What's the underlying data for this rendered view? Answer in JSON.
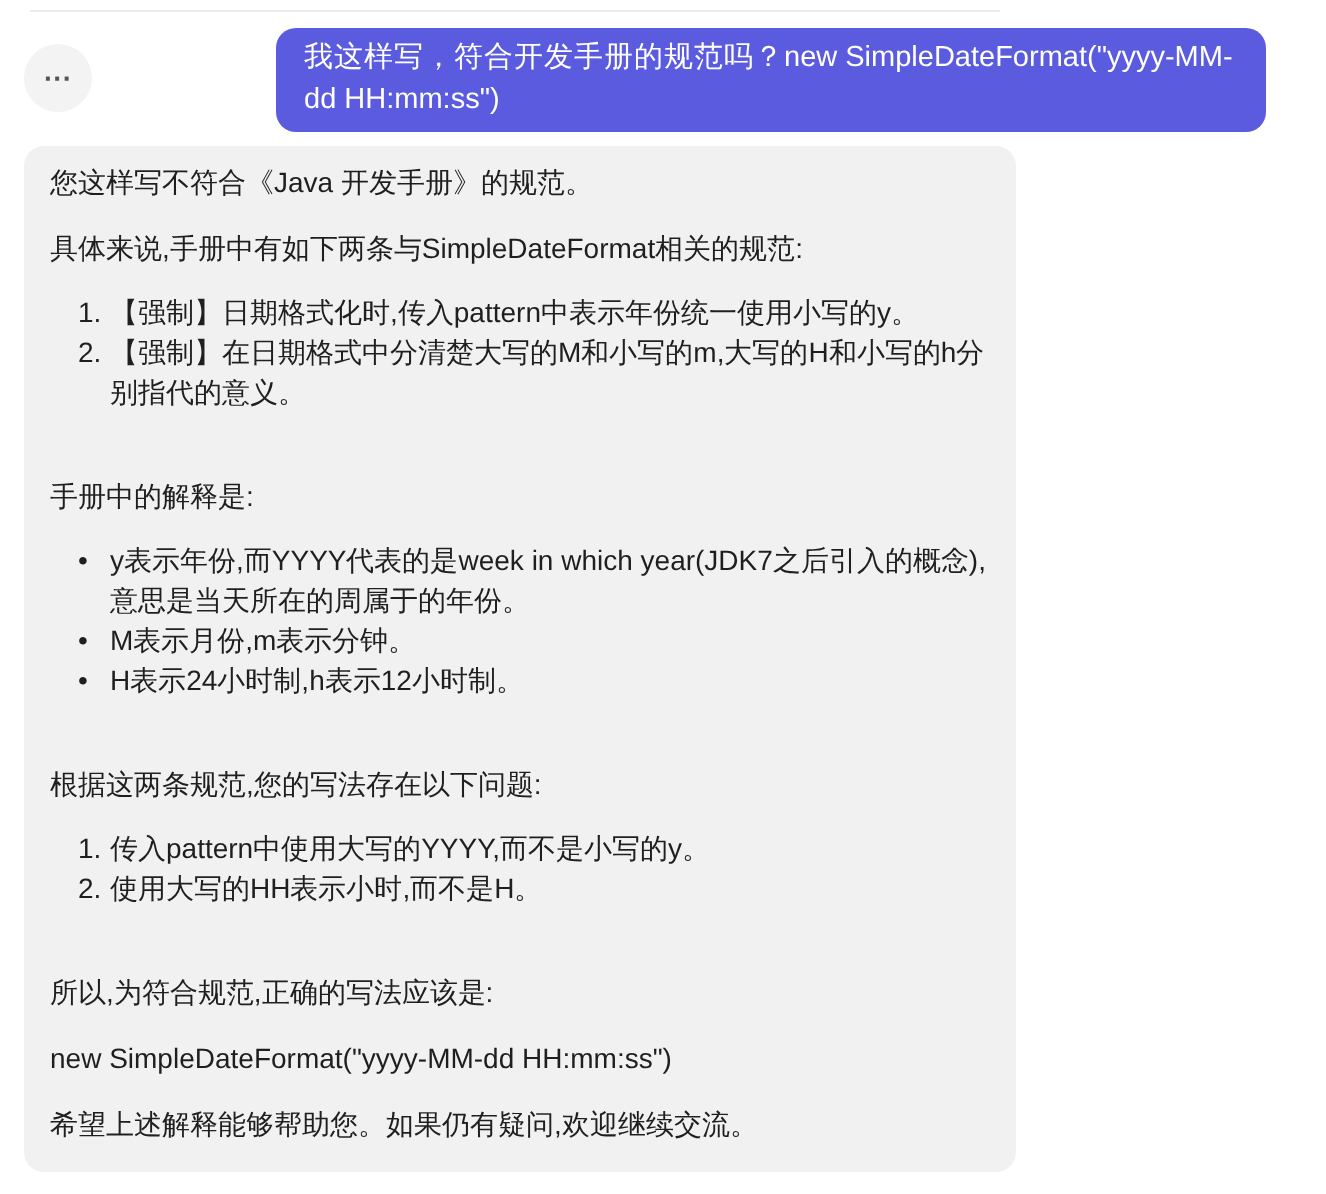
{
  "user_message": {
    "text": "我这样写，符合开发手册的规范吗？new SimpleDateFormat(\"yyyy-MM-dd HH:mm:ss\")"
  },
  "more_button": {
    "label": "···"
  },
  "reply": {
    "blocks": [
      {
        "kind": "p",
        "text": "您这样写不符合《Java 开发手册》的规范。"
      },
      {
        "kind": "p",
        "text": "具体来说,手册中有如下两条与SimpleDateFormat相关的规范:"
      },
      {
        "kind": "ol",
        "items": [
          {
            "marker": "1.",
            "text": "【强制】日期格式化时,传入pattern中表示年份统一使用小写的y。"
          },
          {
            "marker": "2.",
            "text": "【强制】在日期格式中分清楚大写的M和小写的m,大写的H和小写的h分别指代的意义。"
          }
        ]
      },
      {
        "kind": "p",
        "text": "手册中的解释是:"
      },
      {
        "kind": "ul",
        "items": [
          {
            "marker": "•",
            "text": "y表示年份,而YYYY代表的是week in which year(JDK7之后引入的概念),意思是当天所在的周属于的年份。"
          },
          {
            "marker": "•",
            "text": "M表示月份,m表示分钟。"
          },
          {
            "marker": "•",
            "text": "H表示24小时制,h表示12小时制。"
          }
        ]
      },
      {
        "kind": "p",
        "text": "根据这两条规范,您的写法存在以下问题:"
      },
      {
        "kind": "ol",
        "items": [
          {
            "marker": "1.",
            "text": "传入pattern中使用大写的YYYY,而不是小写的y。"
          },
          {
            "marker": "2.",
            "text": "使用大写的HH表示小时,而不是H。"
          }
        ]
      },
      {
        "kind": "p",
        "text": "所以,为符合规范,正确的写法应该是:"
      },
      {
        "kind": "p",
        "text": "new SimpleDateFormat(\"yyyy-MM-dd HH:mm:ss\")"
      },
      {
        "kind": "p",
        "text": "希望上述解释能够帮助您。如果仍有疑问,欢迎继续交流。"
      }
    ]
  }
}
